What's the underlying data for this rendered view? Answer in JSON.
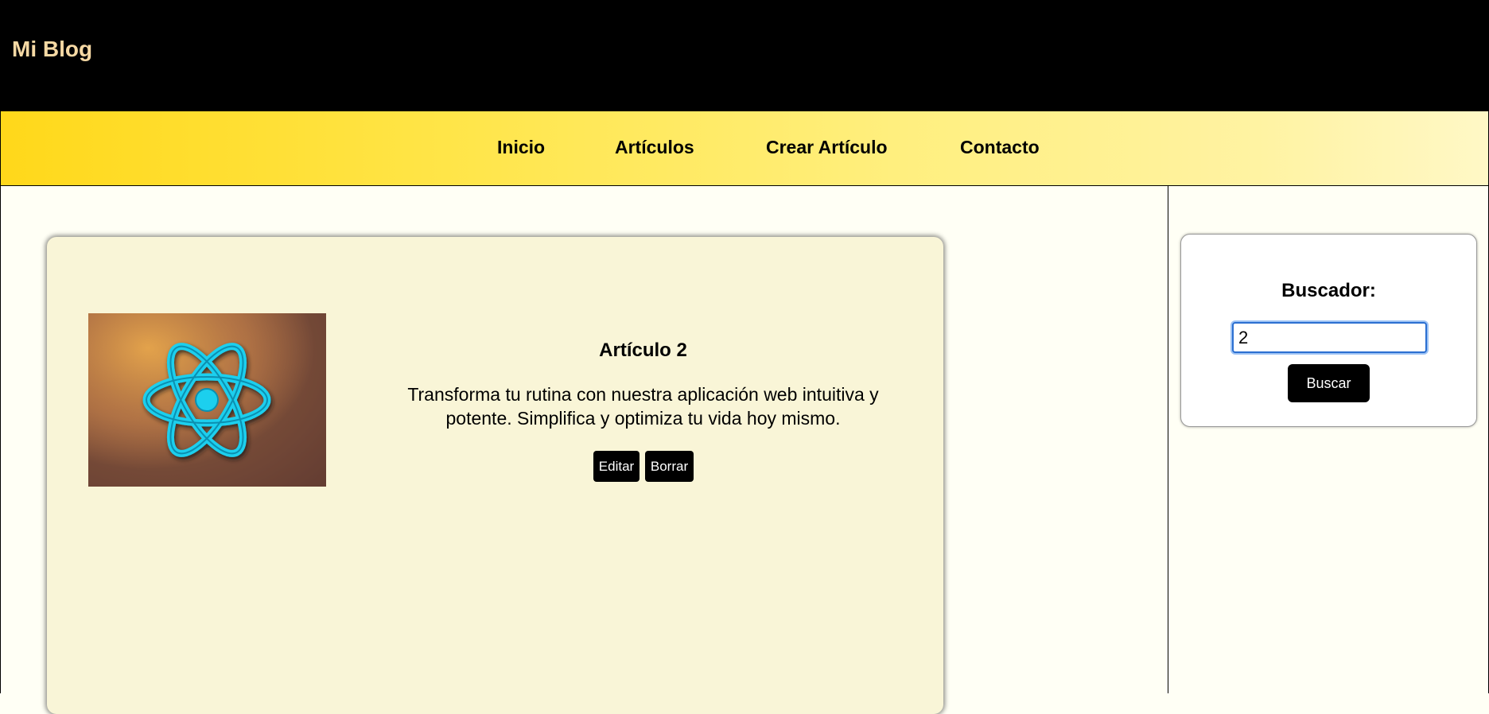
{
  "header": {
    "site_title": "Mi Blog"
  },
  "nav": {
    "items": [
      {
        "label": "Inicio"
      },
      {
        "label": "Artículos"
      },
      {
        "label": "Crear Artículo"
      },
      {
        "label": "Contacto"
      }
    ]
  },
  "article": {
    "image_icon": "react-atom-icon",
    "title": "Artículo 2",
    "text": "Transforma tu rutina con nuestra aplicación web intuitiva y potente. Simplifica y optimiza tu vida hoy mismo.",
    "edit_label": "Editar",
    "delete_label": "Borrar"
  },
  "search": {
    "label": "Buscador:",
    "value": "2",
    "button_label": "Buscar"
  },
  "colors": {
    "header_bg": "#000000",
    "title_color": "#f6d9a4",
    "nav_gradient_start": "#ffd81a",
    "nav_gradient_end": "#fff8c6",
    "card_bg": "#f9f5d7",
    "react_accent": "#1ccfee",
    "focus_ring": "#2b6fd1"
  }
}
